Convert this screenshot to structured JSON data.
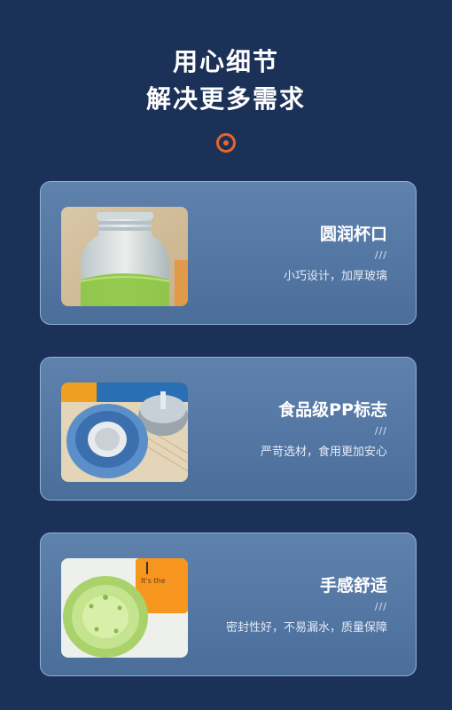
{
  "header": {
    "line1": "用心细节",
    "line2": "解决更多需求"
  },
  "accent_color": "#e8652a",
  "cards": [
    {
      "title": "圆润杯口",
      "slashes": "///",
      "desc": "小巧设计，加厚玻璃",
      "image": "glass-bottle-mouth-photo"
    },
    {
      "title": "食品级PP标志",
      "slashes": "///",
      "desc": "严苛选材，食用更加安心",
      "image": "bottle-cap-photo"
    },
    {
      "title": "手感舒适",
      "slashes": "///",
      "desc": "密封性好，不易漏水，质量保障",
      "image": "bottle-base-photo",
      "photo_text": "It's the"
    }
  ]
}
